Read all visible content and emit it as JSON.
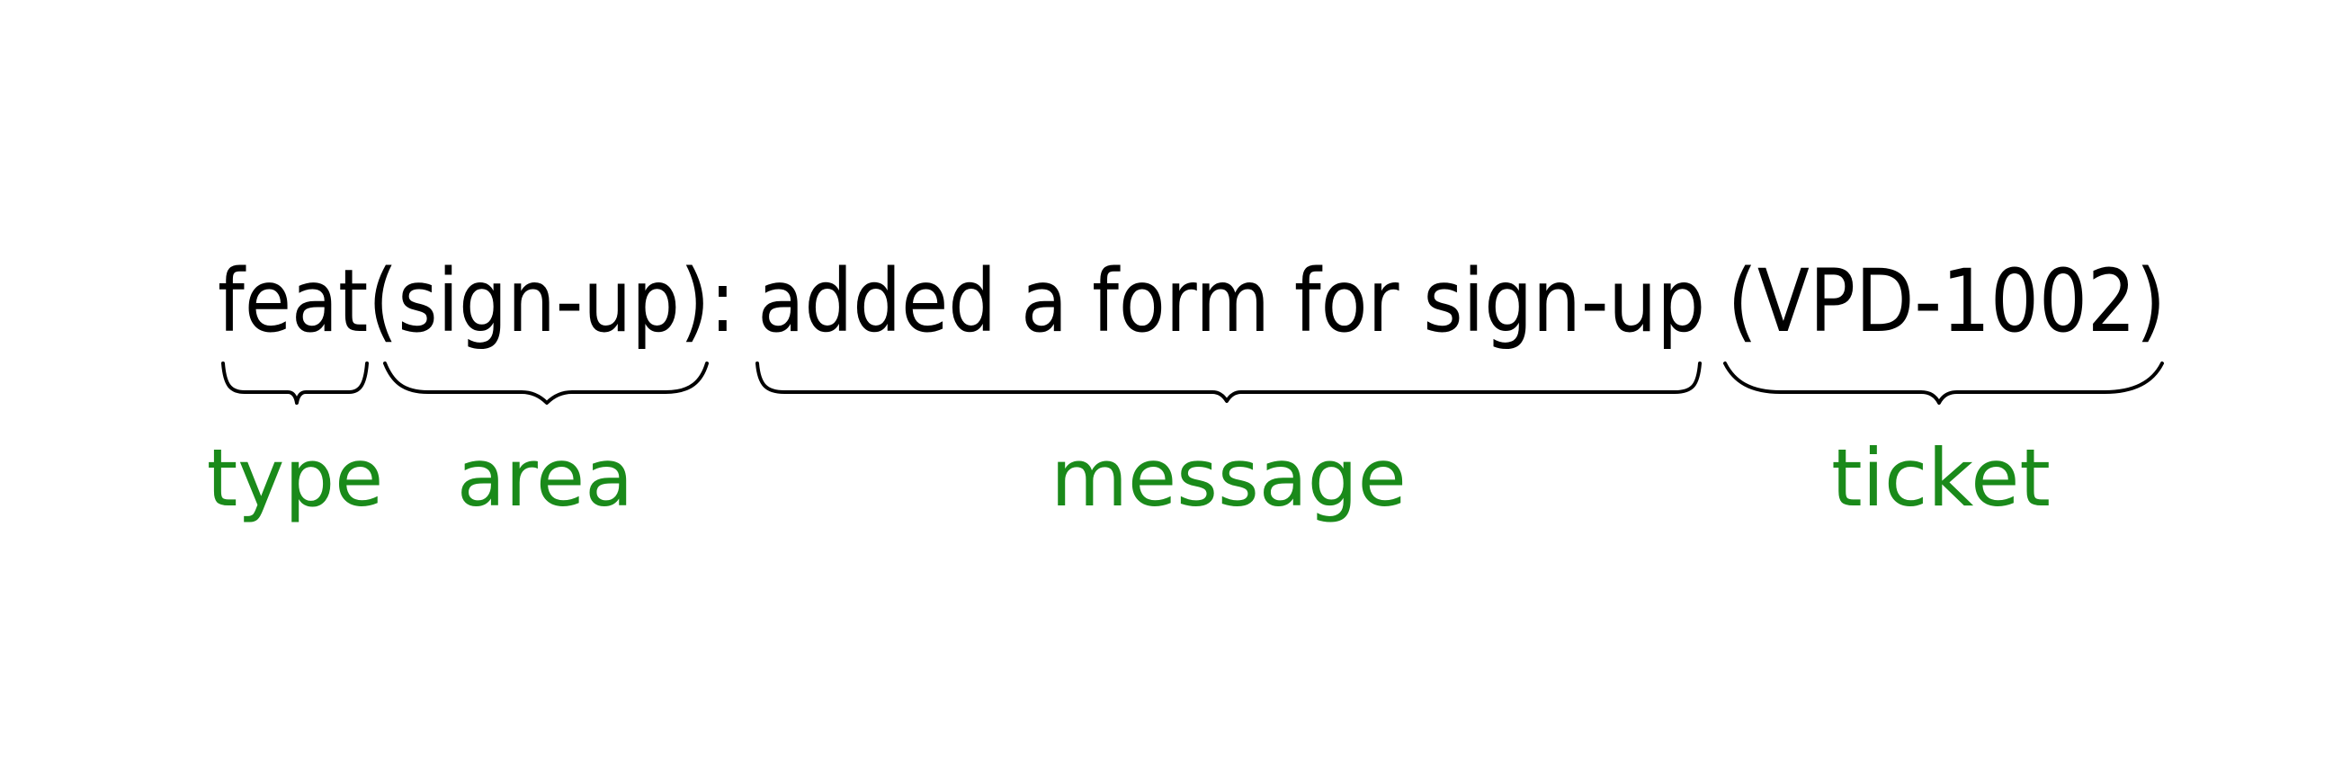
{
  "commit": {
    "type": "feat",
    "open_paren": "(",
    "area": "sign-up",
    "close_paren_colon": "):",
    "message": "added a form for sign-up",
    "ticket": "(VPD-1002)"
  },
  "labels": {
    "type": "type",
    "area": "area",
    "message": "message",
    "ticket": "ticket"
  },
  "colors": {
    "text": "#000000",
    "label": "#1a8a1a",
    "brace": "#000000",
    "background": "#ffffff"
  }
}
